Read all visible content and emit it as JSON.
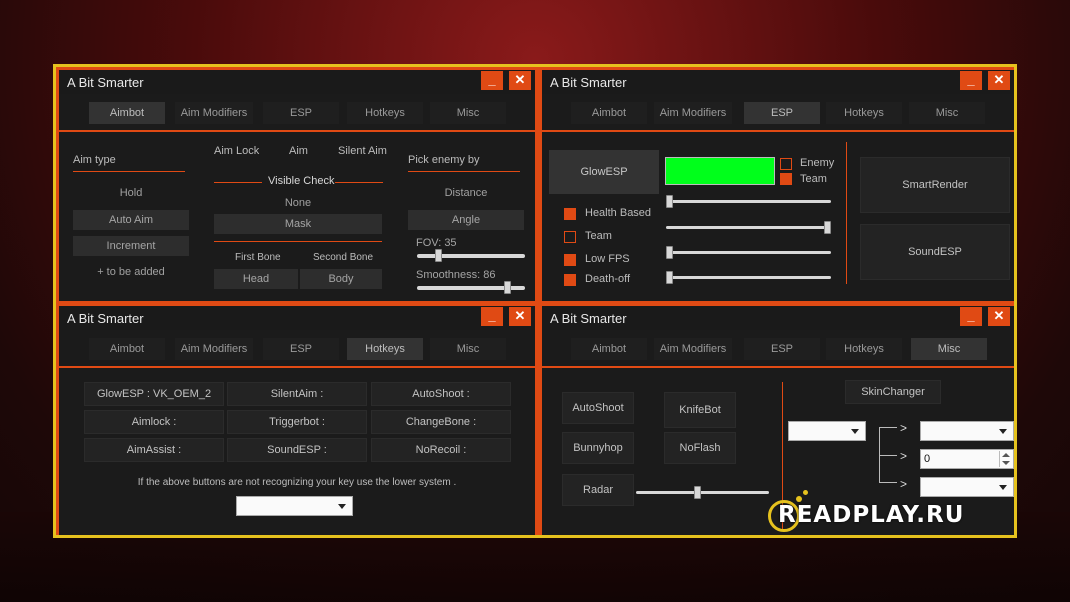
{
  "colors": {
    "accent": "#e04a14",
    "frame": "#e6c21e",
    "glow": "#00ff1b"
  },
  "app_title": "A Bit Smarter",
  "window_buttons": {
    "minimize": "_",
    "close": "✕"
  },
  "tabs": [
    "Aimbot",
    "Aim Modifiers",
    "ESP",
    "Hotkeys",
    "Misc"
  ],
  "aimbot": {
    "aim_type_label": "Aim type",
    "aim_types": [
      "Hold",
      "Auto Aim",
      "Increment",
      "+ to be added"
    ],
    "modes": [
      "Aim Lock",
      "Aim",
      "Silent Aim"
    ],
    "visible_check_label": "Visible Check",
    "visible_options": [
      "None",
      "Mask"
    ],
    "first_bone_label": "First Bone",
    "second_bone_label": "Second Bone",
    "first_bone": "Head",
    "second_bone": "Body",
    "pick_enemy_label": "Pick enemy by",
    "pick_options": [
      "Distance",
      "Angle"
    ],
    "fov_label": "FOV: 35",
    "fov_value": 35,
    "smoothness_label": "Smoothness: 86",
    "smoothness_value": 86
  },
  "esp": {
    "glow_button": "GlowESP",
    "enemy_label": "Enemy",
    "team_label": "Team",
    "health_based": "Health Based",
    "team": "Team",
    "low_fps": "Low FPS",
    "death_off": "Death-off",
    "smart_render": "SmartRender",
    "sound_esp": "SoundESP",
    "slider_values": [
      0,
      1,
      0,
      0
    ]
  },
  "hotkeys": {
    "buttons": [
      "GlowESP : VK_OEM_2",
      "SilentAim : ",
      "AutoShoot : ",
      "Aimlock : ",
      "Triggerbot : ",
      "ChangeBone : ",
      "AimAssist : ",
      "SoundESP : ",
      "NoRecoil : "
    ],
    "note": "If the above buttons are not recognizing your key use the lower system ."
  },
  "misc": {
    "auto_shoot": "AutoShoot",
    "knife_bot": "KnifeBot",
    "bunnyhop": "Bunnyhop",
    "no_flash": "NoFlash",
    "radar": "Radar",
    "radar_slider_value": 0.46,
    "skin_changer": "SkinChanger",
    "gt": ">",
    "numeric_value": "0"
  },
  "watermark": "READPLAY.RU"
}
